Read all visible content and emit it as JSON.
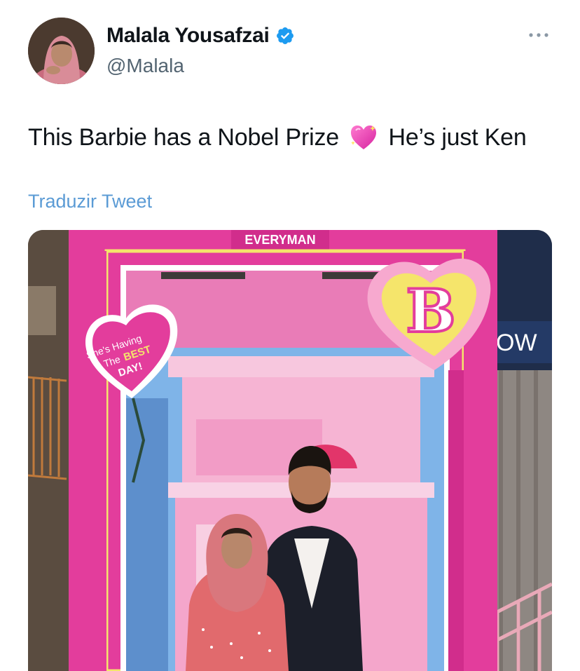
{
  "author": {
    "display_name": "Malala Yousafzai",
    "handle": "@Malala",
    "verified": true,
    "avatar_icon": "profile-photo"
  },
  "more_menu_icon": "more-horizontal-icon",
  "tweet": {
    "text_before_emoji": "This Barbie has a Nobel Prize",
    "emoji": "sparkling-heart",
    "text_after_emoji": "He’s just Ken"
  },
  "translate_label": "Traduzir Tweet",
  "media": {
    "sign_text": "EVERYMAN",
    "heart_badge_line1": "She's Having",
    "heart_badge_line2": "The",
    "heart_badge_best": "BEST",
    "heart_badge_day": "DAY!",
    "logo_letter": "B",
    "right_sign_text": "OW",
    "colors": {
      "barbie_pink": "#e33d9c",
      "light_pink": "#f7a9cf",
      "yellow_trim": "#f5e56b",
      "sky_blue": "#7fb4e8"
    }
  }
}
